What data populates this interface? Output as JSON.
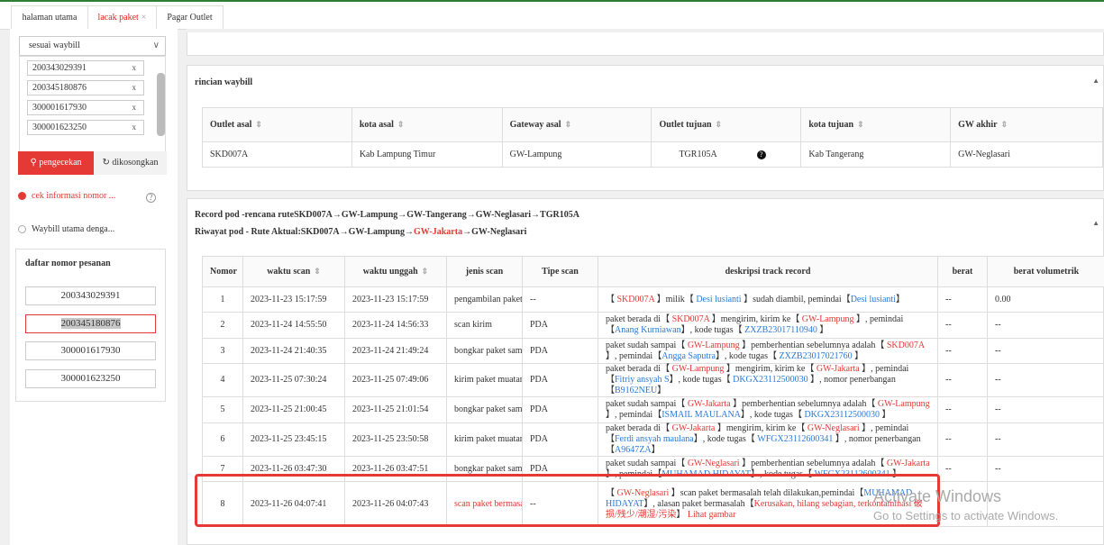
{
  "tabs": [
    {
      "label": "halaman utama"
    },
    {
      "label": "lacak paket",
      "close": "×"
    },
    {
      "label": "Pagar Outlet"
    }
  ],
  "sidebar": {
    "select_value": "sesuai waybill",
    "chevron": "chevron-down-icon",
    "waybills": [
      "200343029391",
      "200345180876",
      "300001617930",
      "300001623250"
    ],
    "remove_label": "x",
    "search_button": "pengecekan",
    "collapse_button": "dikosongkan",
    "option1": "cek informasi nomor ...",
    "option2": "Waybill utama denga...",
    "daftar_title": "daftar nomor pesanan",
    "daftar_items": [
      "200343029391",
      "200345180876",
      "300001617930",
      "300001623250"
    ]
  },
  "rincian": {
    "title": "rincian waybill",
    "headers": [
      "Outlet asal",
      "kota asal",
      "Gateway asal",
      "Outlet tujuan",
      "kota tujuan",
      "GW akhir"
    ],
    "row": [
      "SKD007A",
      "Kab Lampung Timur",
      "GW-Lampung",
      "TGR105A",
      "Kab Tangerang",
      "GW-Neglasari"
    ]
  },
  "record": {
    "line1": "Record pod -rencana ruteSKD007A→GW-Lampung→GW-Tangerang→GW-Neglasari→TGR105A",
    "line2_prefix": "Riwayat pod - Rute Aktual:SKD007A→GW-Lampung→",
    "line2_red": "GW-Jakarta",
    "line2_suffix": "→GW-Neglasari",
    "headers": [
      "Nomor",
      "waktu scan",
      "waktu unggah",
      "jenis scan",
      "Tipe scan",
      "deskripsi track record",
      "berat",
      "berat volumetrik"
    ],
    "rows": [
      {
        "no": "1",
        "scan": "2023-11-23 15:17:59",
        "upload": "2023-11-23 15:17:59",
        "jenis": "pengambilan paket",
        "tipe": "--",
        "desc": [
          [
            "t",
            "【 "
          ],
          [
            "r",
            "SKD007A"
          ],
          [
            "t",
            " 】milik【 "
          ],
          [
            "b",
            "Desi lusianti"
          ],
          [
            "t",
            " 】sudah diambil,  pemindai【"
          ],
          [
            "b",
            "Desi lusianti"
          ],
          [
            "t",
            "】"
          ]
        ],
        "berat": "--",
        "vol": "0.00"
      },
      {
        "no": "2",
        "scan": "2023-11-24 14:55:50",
        "upload": "2023-11-24 14:56:33",
        "jenis": "scan kirim",
        "tipe": "PDA",
        "desc": [
          [
            "t",
            "paket berada di【 "
          ],
          [
            "r",
            "SKD007A"
          ],
          [
            "t",
            " 】mengirim, kirim ke【 "
          ],
          [
            "r",
            "GW-Lampung"
          ],
          [
            "t",
            " 】,  pemindai【"
          ],
          [
            "b",
            "Anang Kurniawan"
          ],
          [
            "t",
            "】,  kode tugas【 "
          ],
          [
            "b",
            "ZXZB23017110940"
          ],
          [
            "t",
            " 】"
          ]
        ],
        "berat": "--",
        "vol": "--"
      },
      {
        "no": "3",
        "scan": "2023-11-24 21:40:35",
        "upload": "2023-11-24 21:49:24",
        "jenis": "bongkar paket sampai",
        "tipe": "PDA",
        "desc": [
          [
            "t",
            "paket sudah sampai【 "
          ],
          [
            "r",
            "GW-Lampung"
          ],
          [
            "t",
            " 】pemberhentian sebelumnya adalah【 "
          ],
          [
            "r",
            "SKD007A"
          ],
          [
            "t",
            " 】,  pemindai【"
          ],
          [
            "b",
            "Angga Saputra"
          ],
          [
            "t",
            "】,  kode tugas【 "
          ],
          [
            "b",
            "ZXZB23017021760"
          ],
          [
            "t",
            " 】"
          ]
        ],
        "berat": "--",
        "vol": "--"
      },
      {
        "no": "4",
        "scan": "2023-11-25 07:30:24",
        "upload": "2023-11-25 07:49:06",
        "jenis": "kirim paket muatan",
        "tipe": "PDA",
        "desc": [
          [
            "t",
            "paket berada di【 "
          ],
          [
            "r",
            "GW-Lampung"
          ],
          [
            "t",
            " 】mengirim, kirim ke【 "
          ],
          [
            "r",
            "GW-Jakarta"
          ],
          [
            "t",
            " 】,  pemindai【"
          ],
          [
            "b",
            "Fitriy ansyah S"
          ],
          [
            "t",
            "】,  kode tugas【 "
          ],
          [
            "b",
            "DKGX23112500030"
          ],
          [
            "t",
            " 】,  nomor penerbangan【"
          ],
          [
            "b",
            "B9162NEU"
          ],
          [
            "t",
            "】"
          ]
        ],
        "berat": "--",
        "vol": "--"
      },
      {
        "no": "5",
        "scan": "2023-11-25 21:00:45",
        "upload": "2023-11-25 21:01:54",
        "jenis": "bongkar paket sampai",
        "tipe": "PDA",
        "desc": [
          [
            "t",
            "paket sudah sampai【 "
          ],
          [
            "r",
            "GW-Jakarta"
          ],
          [
            "t",
            " 】pemberhentian sebelumnya adalah【 "
          ],
          [
            "r",
            "GW-Lampung"
          ],
          [
            "t",
            " 】,  pemindai【"
          ],
          [
            "b",
            "ISMAIL MAULANA"
          ],
          [
            "t",
            "】,  kode tugas【 "
          ],
          [
            "b",
            "DKGX23112500030"
          ],
          [
            "t",
            " 】"
          ]
        ],
        "berat": "--",
        "vol": "--"
      },
      {
        "no": "6",
        "scan": "2023-11-25 23:45:15",
        "upload": "2023-11-25 23:50:58",
        "jenis": "kirim paket muatan",
        "tipe": "PDA",
        "desc": [
          [
            "t",
            "paket berada di【 "
          ],
          [
            "r",
            "GW-Jakarta"
          ],
          [
            "t",
            " 】mengirim, kirim ke【 "
          ],
          [
            "r",
            "GW-Neglasari"
          ],
          [
            "t",
            " 】,  pemindai【"
          ],
          [
            "b",
            "Ferdi ansyah maulana"
          ],
          [
            "t",
            "】,  kode tugas【 "
          ],
          [
            "b",
            "WFGX23112600341"
          ],
          [
            "t",
            " 】,  nomor penerbangan【"
          ],
          [
            "b",
            "A9647ZA"
          ],
          [
            "t",
            "】"
          ]
        ],
        "berat": "--",
        "vol": "--"
      },
      {
        "no": "7",
        "scan": "2023-11-26 03:47:30",
        "upload": "2023-11-26 03:47:51",
        "jenis": "bongkar paket sampai",
        "tipe": "PDA",
        "desc": [
          [
            "t",
            "paket sudah sampai【 "
          ],
          [
            "r",
            "GW-Neglasari"
          ],
          [
            "t",
            " 】pemberhentian sebelumnya adalah【 "
          ],
          [
            "r",
            "GW-Jakarta"
          ],
          [
            "t",
            " 】,  pemindai【"
          ],
          [
            "b",
            "MUHAMAD HIDAYAT"
          ],
          [
            "t",
            "】,  kode tugas【 "
          ],
          [
            "b",
            "WFGX23112600341"
          ],
          [
            "t",
            " 】"
          ]
        ],
        "berat": "--",
        "vol": "--"
      },
      {
        "no": "8",
        "scan": "2023-11-26 04:07:41",
        "upload": "2023-11-26 04:07:43",
        "jenis": "scan paket bermasalah",
        "tipe": "--",
        "desc": [
          [
            "t",
            "【 "
          ],
          [
            "r",
            "GW-Neglasari"
          ],
          [
            "t",
            " 】scan paket bermasalah telah dilakukan,pemindai【"
          ],
          [
            "b",
            "MUHAMAD HIDAYAT"
          ],
          [
            "t",
            "】,  alasan paket bermasalah【"
          ],
          [
            "r",
            "Kerusakan, hilang sebagian, terkontaminasi 破损/残少/潮湿/污染"
          ],
          [
            "t",
            "】  "
          ],
          [
            "r",
            "Lihat gambar"
          ]
        ],
        "berat": "",
        "vol": ""
      }
    ]
  },
  "watermark": {
    "line1": "Activate Windows",
    "line2": "Go to Settings to activate Windows."
  }
}
